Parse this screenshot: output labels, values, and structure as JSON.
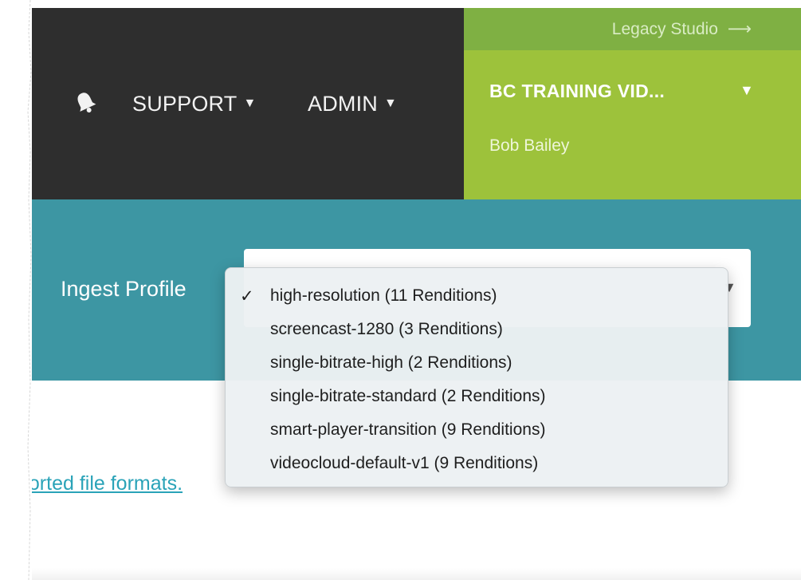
{
  "nav": {
    "support_label": "SUPPORT",
    "admin_label": "ADMIN",
    "caret": "▼"
  },
  "legacy": {
    "label": "Legacy Studio",
    "arrow": "⟶"
  },
  "account": {
    "name": "BC TRAINING VID...",
    "caret": "▼",
    "user": "Bob Bailey"
  },
  "ingest": {
    "label": "Ingest Profile",
    "selected": "high-resolution (11 Renditions)",
    "options": [
      "high-resolution (11 Renditions)",
      "screencast-1280 (3 Renditions)",
      "single-bitrate-high (2 Renditions)",
      "single-bitrate-standard (2 Renditions)",
      "smart-player-transition (9 Renditions)",
      "videocloud-default-v1 (9 Renditions)"
    ],
    "check": "✓"
  },
  "links": {
    "formats_partial": "ported file formats."
  },
  "colors": {
    "dark_bar": "#2e2e2e",
    "legacy_green": "#7fb043",
    "account_green": "#9dc23b",
    "teal": "#3d96a3",
    "link": "#2aa3b8"
  },
  "icons": {
    "notifications": "bell-icon",
    "arrow": "arrow-right-icon"
  }
}
